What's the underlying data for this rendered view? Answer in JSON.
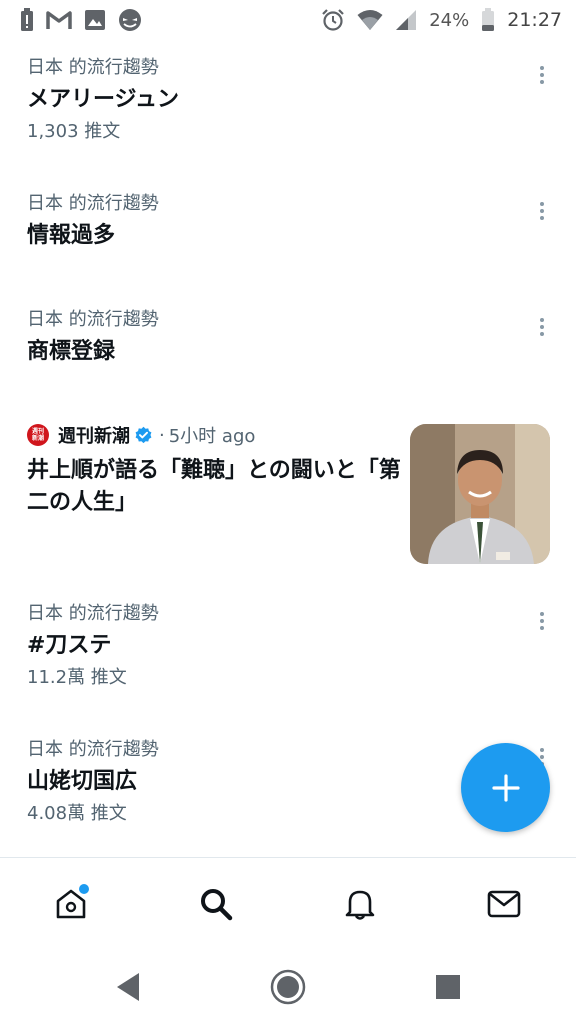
{
  "status_bar": {
    "time": "21:27",
    "battery_percent": "24%",
    "left_icons": [
      "battery-alert-icon",
      "gmail-icon",
      "image-icon",
      "mask-icon"
    ],
    "right_icons": [
      "alarm-icon",
      "wifi-icon",
      "signal-icon",
      "battery-icon"
    ]
  },
  "trends": [
    {
      "context": "日本 的流行趨勢",
      "name": "メアリージュン",
      "count": "1,303 推文"
    },
    {
      "context": "日本 的流行趨勢",
      "name": "情報過多",
      "count": ""
    },
    {
      "context": "日本 的流行趨勢",
      "name": "商標登録",
      "count": ""
    },
    {
      "context": "日本 的流行趨勢",
      "name": "#刀ステ",
      "count": "11.2萬 推文"
    },
    {
      "context": "日本 的流行趨勢",
      "name": "山姥切国広",
      "count": "4.08萬 推文"
    }
  ],
  "news": {
    "source": "週刊新潮",
    "logo_text": "週刊新潮",
    "separator": "·",
    "time": "5小时 ago",
    "headline": "井上順が語る「難聴」との闘いと「第二の人生」"
  },
  "fab": {
    "icon": "plus-icon",
    "color": "#1d9bf0"
  },
  "bottom_nav": {
    "items": [
      "home-icon",
      "search-icon",
      "notifications-icon",
      "messages-icon"
    ],
    "home_has_notification_dot": true
  },
  "system_nav": [
    "back-icon",
    "home-button-icon",
    "recents-icon"
  ],
  "colors": {
    "accent": "#1d9bf0",
    "secondary_text": "#536471",
    "primary_text": "#0f1419",
    "logo_red": "#d0151c"
  }
}
